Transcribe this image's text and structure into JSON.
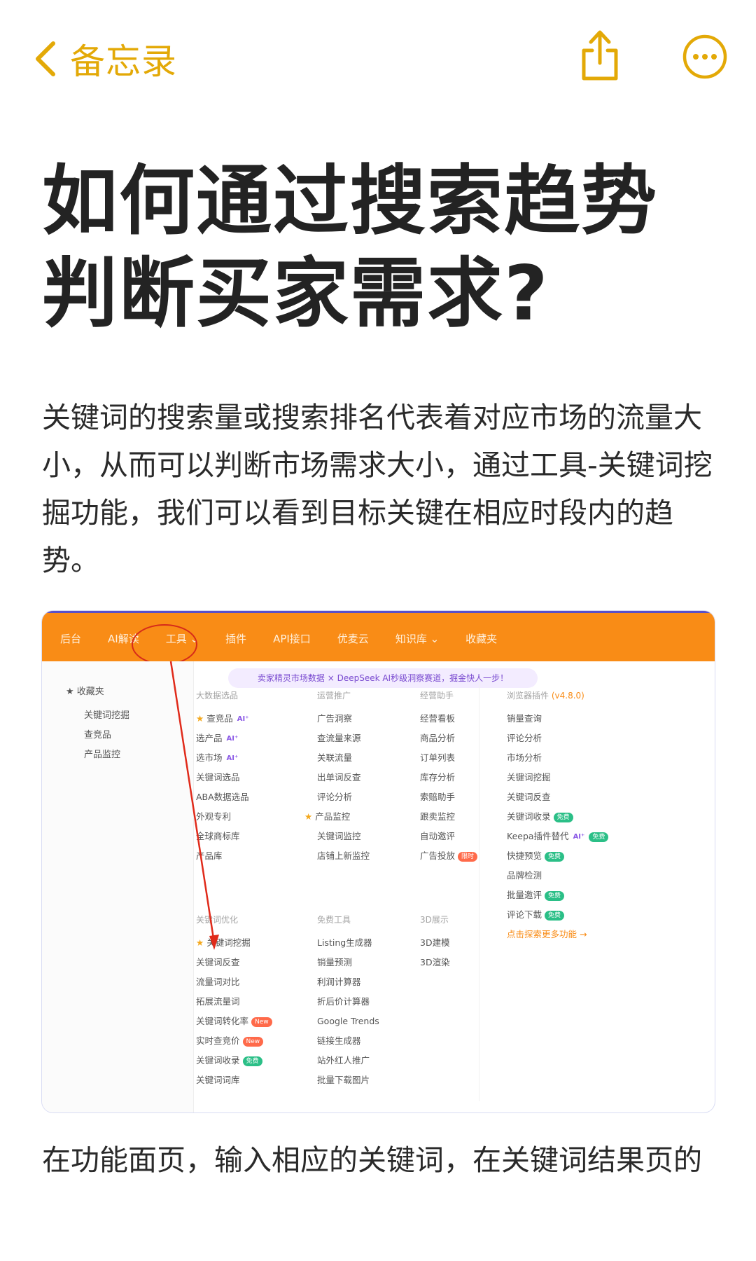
{
  "nav": {
    "back_label": "备忘录"
  },
  "note": {
    "title_line1": "如何通过搜索趋势",
    "title_line2": "判断买家需求?",
    "paragraph1": "关键词的搜索量或搜索排名代表着对应市场的流量大小，从而可以判断市场需求大小，通过工具-关键词挖掘功能，我们可以看到目标关键在相应时段内的趋势。",
    "paragraph2": "在功能面页，输入相应的关键词，在关键词结果页的"
  },
  "screenshot": {
    "menu": [
      "后台",
      "AI解读",
      "工具 ⌄",
      "插件",
      "API接口",
      "优麦云",
      "知识库 ⌄",
      "收藏夹"
    ],
    "left_panel": {
      "favorites": "收藏夹",
      "items": [
        "关键词挖掘",
        "查竞品",
        "产品监控"
      ]
    },
    "banner": "卖家精灵市场数据 × DeepSeek AI秒级洞察赛道，掘金快人一步！",
    "col1": {
      "header": "大数据选品",
      "items": [
        "查竞品",
        "选产品",
        "选市场",
        "关键词选品",
        "ABA数据选品",
        "外观专利",
        "全球商标库",
        "产品库"
      ]
    },
    "col2": {
      "header": "运营推广",
      "items": [
        "广告洞察",
        "查流量来源",
        "关联流量",
        "出单词反查",
        "评论分析",
        "产品监控",
        "关键词监控",
        "店铺上新监控"
      ]
    },
    "col3": {
      "header": "经营助手",
      "items": [
        "经营看板",
        "商品分析",
        "订单列表",
        "库存分析",
        "索赔助手",
        "跟卖监控",
        "自动邀评",
        "广告投放"
      ]
    },
    "col4": {
      "header": "浏览器插件",
      "version": "(v4.8.0)",
      "items": [
        "销量查询",
        "评论分析",
        "市场分析",
        "关键词挖掘",
        "关键词反查",
        "关键词收录",
        "Keepa插件替代",
        "快捷预览",
        "品牌检测",
        "批量邀评",
        "评论下载"
      ],
      "more": "点击探索更多功能 →"
    },
    "col5": {
      "header": "关键词优化",
      "items": [
        "关键词挖掘",
        "关键词反查",
        "流量词对比",
        "拓展流量词",
        "关键词转化率",
        "实时查竞价",
        "关键词收录",
        "关键词词库"
      ]
    },
    "col6": {
      "header": "免费工具",
      "items": [
        "Listing生成器",
        "销量预测",
        "利润计算器",
        "折后价计算器",
        "Google Trends",
        "链接生成器",
        "站外红人推广",
        "批量下载图片"
      ]
    },
    "col7": {
      "header": "3D展示",
      "items": [
        "3D建模",
        "3D渲染"
      ]
    },
    "tags": {
      "ai": "AI⁺",
      "free": "免费",
      "new": "New",
      "limited": "限时"
    }
  }
}
